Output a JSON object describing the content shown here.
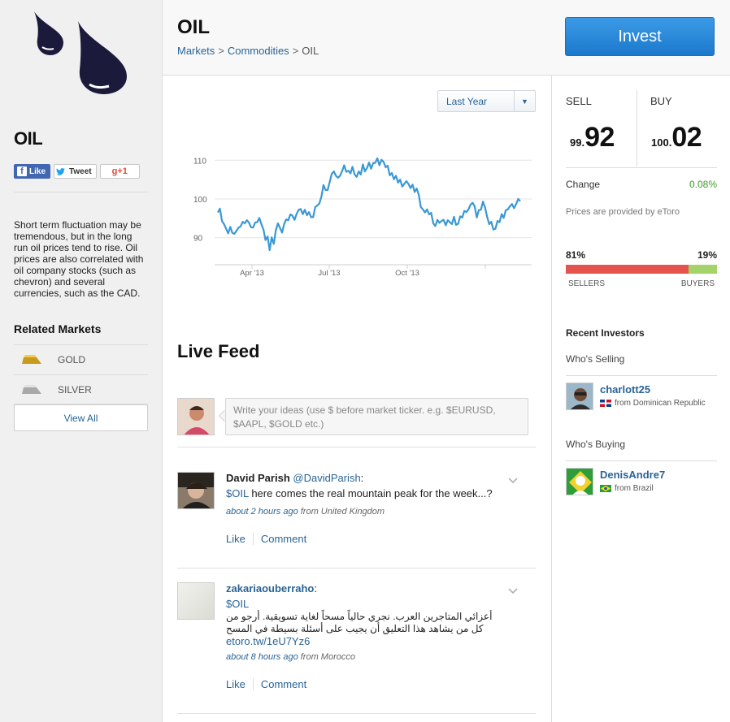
{
  "sidebar": {
    "title": "OIL",
    "social": {
      "like": "Like",
      "tweet": "Tweet",
      "gplus": "+1"
    },
    "description": "Short term fluctuation may be tremendous, but in the long run oil prices tend to rise. Oil prices are also correlated with oil company stocks (such as chevron) and several currencies, such as the CAD.",
    "related_title": "Related Markets",
    "related": [
      {
        "label": "GOLD",
        "icon": "gold-bar-icon"
      },
      {
        "label": "SILVER",
        "icon": "silver-bar-icon"
      }
    ],
    "view_all": "View All"
  },
  "header": {
    "title": "OIL",
    "breadcrumb": [
      "Markets",
      "Commodities",
      "OIL"
    ],
    "invest_label": "Invest"
  },
  "main": {
    "range_select": "Last Year",
    "live_feed_title": "Live Feed",
    "compose_placeholder": "Write your ideas (use $ before market ticker. e.g. $EURUSD, $AAPL, $GOLD etc.)",
    "posts": [
      {
        "author": "David Parish",
        "handle": "@DavidParish",
        "ticker": "$OIL",
        "text": "here comes the real mountain peak for the week...?",
        "when": "about 2 hours ago",
        "from": "from United Kingdom",
        "like": "Like",
        "comment": "Comment"
      },
      {
        "author": "zakariaouberraho",
        "ticker": "$OIL",
        "arabic": "أعزائي المتاجرين العرب. نجري حالياً مسحاً لغاية تسويقية. أرجو من كل من يشاهد هذا التعليق أن يجيب على أسئلة بسيطة في المسح",
        "link": "etoro.tw/1eU7Yz6",
        "when": "about 8 hours ago",
        "from": "from Morocco",
        "like": "Like",
        "comment": "Comment"
      }
    ]
  },
  "prices": {
    "sell_label": "SELL",
    "sell_small": "99.",
    "sell_big": "92",
    "buy_label": "BUY",
    "buy_small": "100.",
    "buy_big": "02",
    "change_label": "Change",
    "change_value": "0.08%",
    "provider": "Prices are provided by eToro",
    "sellers_pct": "81%",
    "buyers_pct": "19%",
    "sellers_fraction": 0.81,
    "sellers_label": "SELLERS",
    "buyers_label": "BUYERS"
  },
  "investors": {
    "title": "Recent Investors",
    "selling_title": "Who's Selling",
    "buying_title": "Who's Buying",
    "seller": {
      "name": "charlott25",
      "from": "from Dominican Republic"
    },
    "buyer": {
      "name": "DenisAndre7",
      "from": "from Brazil"
    }
  },
  "colors": {
    "accent": "#2a6496",
    "invest": "#1b78cb",
    "sellers": "#e5534f",
    "buyers": "#a4d36a",
    "line": "#3a98d4",
    "positive": "#3c9c2c"
  },
  "chart_data": {
    "type": "line",
    "title": "",
    "xlabel": "",
    "ylabel": "",
    "x_ticks": [
      "Apr '13",
      "Jul '13",
      "Oct '13"
    ],
    "y_ticks": [
      90,
      100,
      110
    ],
    "ylim": [
      83,
      113
    ],
    "grid": true,
    "series": [
      {
        "values": [
          96.5,
          97.5,
          94.3,
          93.5,
          92.3,
          91.1,
          92.8,
          91.2,
          91.0,
          91.8,
          92.6,
          92.9,
          94.1,
          93.7,
          94.5,
          93.9,
          92.7,
          92.6,
          93.9,
          94.0,
          95.1,
          93.5,
          92.1,
          89.4,
          90.3,
          86.8,
          90.1,
          88.4,
          91.9,
          93.7,
          92.5,
          91.3,
          93.5,
          94.7,
          94.5,
          96.0,
          95.7,
          94.6,
          96.1,
          97.2,
          97.4,
          96.1,
          97.2,
          95.8,
          96.6,
          95.3,
          95.3,
          97.9,
          98.3,
          98.8,
          100.6,
          103.6,
          102.3,
          102.3,
          104.4,
          106.5,
          107.1,
          106.0,
          105.5,
          106.0,
          107.2,
          108.7,
          107.0,
          107.3,
          106.6,
          108.3,
          106.4,
          105.7,
          107.1,
          106.3,
          108.9,
          107.1,
          108.0,
          109.4,
          107.8,
          109.3,
          109.3,
          110.5,
          108.7,
          110.1,
          109.6,
          108.2,
          108.6,
          106.1,
          106.7,
          105.1,
          106.0,
          104.2,
          105.0,
          103.2,
          103.9,
          104.6,
          103.9,
          102.8,
          103.7,
          101.8,
          102.7,
          101.0,
          97.9,
          97.3,
          96.5,
          97.3,
          96.0,
          96.4,
          93.7,
          93.0,
          94.6,
          93.8,
          94.3,
          94.6,
          93.2,
          94.5,
          94.0,
          93.5,
          95.4,
          93.3,
          93.6,
          95.5,
          95.2,
          96.9,
          96.6,
          97.3,
          98.5,
          99.0,
          98.1,
          95.2,
          97.1,
          97.2,
          99.3,
          97.8,
          95.4,
          93.5,
          94.1,
          92.1,
          92.3,
          94.3,
          94.0,
          96.1,
          95.1,
          97.1,
          97.3,
          98.1,
          98.7,
          97.6,
          98.7,
          100.0,
          99.4
        ]
      }
    ]
  }
}
